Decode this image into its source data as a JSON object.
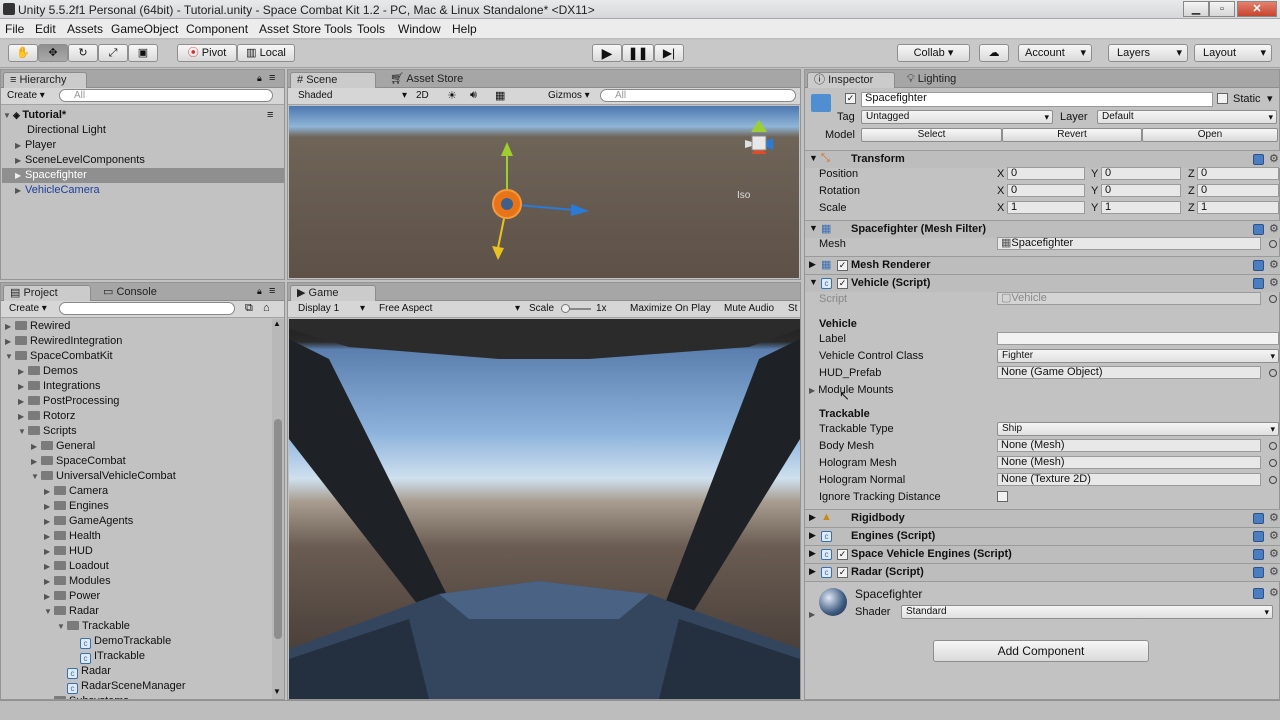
{
  "window": {
    "title": "Unity 5.5.2f1 Personal (64bit) - Tutorial.unity - Space Combat Kit 1.2 - PC, Mac & Linux Standalone* <DX11>"
  },
  "menu": [
    "File",
    "Edit",
    "Assets",
    "GameObject",
    "Component",
    "Asset Store Tools",
    "Tools",
    "Window",
    "Help"
  ],
  "toolbar": {
    "pivot": "Pivot",
    "local": "Local",
    "collab": "Collab ▾",
    "account": "Account",
    "layers": "Layers",
    "layout": "Layout"
  },
  "hierarchy": {
    "tab": "Hierarchy",
    "create": "Create",
    "search_placeholder": "All",
    "scene": "Tutorial*",
    "items": [
      "Directional Light",
      "Player",
      "SceneLevelComponents",
      "Spacefighter",
      "VehicleCamera"
    ]
  },
  "scene_view": {
    "tab_scene": "Scene",
    "tab_store": "Asset Store",
    "shading": "Shaded",
    "mode_2d": "2D",
    "gizmos": "Gizmos",
    "search_placeholder": "All",
    "persp": "Iso"
  },
  "game_view": {
    "tab": "Game",
    "display": "Display 1",
    "aspect": "Free Aspect",
    "scale_label": "Scale",
    "scale_value": "1x",
    "maximize": "Maximize On Play",
    "mute": "Mute Audio",
    "stats": "St"
  },
  "project": {
    "tab_project": "Project",
    "tab_console": "Console",
    "create": "Create",
    "tree": [
      {
        "label": "Rewired",
        "depth": 0
      },
      {
        "label": "RewiredIntegration",
        "depth": 0
      },
      {
        "label": "SpaceCombatKit",
        "depth": 0
      },
      {
        "label": "Demos",
        "depth": 1
      },
      {
        "label": "Integrations",
        "depth": 1
      },
      {
        "label": "PostProcessing",
        "depth": 1
      },
      {
        "label": "Rotorz",
        "depth": 1
      },
      {
        "label": "Scripts",
        "depth": 1
      },
      {
        "label": "General",
        "depth": 2
      },
      {
        "label": "SpaceCombat",
        "depth": 2
      },
      {
        "label": "UniversalVehicleCombat",
        "depth": 2
      },
      {
        "label": "Camera",
        "depth": 3
      },
      {
        "label": "Engines",
        "depth": 3
      },
      {
        "label": "GameAgents",
        "depth": 3
      },
      {
        "label": "Health",
        "depth": 3
      },
      {
        "label": "HUD",
        "depth": 3
      },
      {
        "label": "Loadout",
        "depth": 3
      },
      {
        "label": "Modules",
        "depth": 3
      },
      {
        "label": "Power",
        "depth": 3
      },
      {
        "label": "Radar",
        "depth": 3
      },
      {
        "label": "Trackable",
        "depth": 4
      },
      {
        "label": "DemoTrackable",
        "depth": 5
      },
      {
        "label": "ITrackable",
        "depth": 5
      },
      {
        "label": "Radar",
        "depth": 4
      },
      {
        "label": "RadarSceneManager",
        "depth": 4
      },
      {
        "label": "Subsystems",
        "depth": 3
      }
    ]
  },
  "inspector": {
    "tab": "Inspector",
    "tab_lighting": "Lighting",
    "object_name": "Spacefighter",
    "static": "Static",
    "tag_label": "Tag",
    "tag_value": "Untagged",
    "layer_label": "Layer",
    "layer_value": "Default",
    "model_label": "Model",
    "model_select": "Select",
    "model_revert": "Revert",
    "model_open": "Open",
    "transform": {
      "title": "Transform",
      "rows": [
        {
          "label": "Position",
          "x": "0",
          "y": "0",
          "z": "0"
        },
        {
          "label": "Rotation",
          "x": "0",
          "y": "0",
          "z": "0"
        },
        {
          "label": "Scale",
          "x": "1",
          "y": "1",
          "z": "1"
        }
      ]
    },
    "mesh_filter": {
      "title": "Spacefighter (Mesh Filter)",
      "mesh_label": "Mesh",
      "mesh_value": "Spacefighter"
    },
    "mesh_renderer": {
      "title": "Mesh Renderer"
    },
    "vehicle": {
      "title": "Vehicle (Script)",
      "script_label": "Script",
      "script_value": "Vehicle",
      "section_vehicle": "Vehicle",
      "label_label": "Label",
      "label_value": "",
      "vcc_label": "Vehicle Control Class",
      "vcc_value": "Fighter",
      "hud_label": "HUD_Prefab",
      "hud_value": "None (Game Object)",
      "module_mounts": "Module Mounts",
      "section_trackable": "Trackable",
      "ttype_label": "Trackable Type",
      "ttype_value": "Ship",
      "body_label": "Body Mesh",
      "body_value": "None (Mesh)",
      "holo_label": "Hologram Mesh",
      "holo_value": "None (Mesh)",
      "holon_label": "Hologram Normal",
      "holon_value": "None (Texture 2D)",
      "ignore_label": "Ignore Tracking Distance"
    },
    "rigidbody": {
      "title": "Rigidbody"
    },
    "engines": {
      "title": "Engines (Script)"
    },
    "sv_engines": {
      "title": "Space Vehicle Engines (Script)"
    },
    "radar": {
      "title": "Radar (Script)"
    },
    "material": {
      "name": "Spacefighter",
      "shader_label": "Shader",
      "shader_value": "Standard"
    },
    "add_component": "Add Component"
  },
  "colors": {
    "sky_top": "#5f86b5",
    "ground": "#6e6156",
    "scene_ground": "#5c5047"
  }
}
